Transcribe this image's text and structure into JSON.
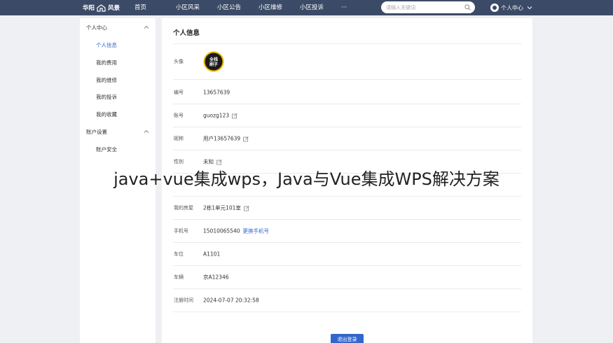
{
  "brand": {
    "name": "华阳",
    "name2": "风景"
  },
  "nav": [
    "首页",
    "小区风采",
    "小区公告",
    "小区维修",
    "小区投诉",
    "···"
  ],
  "search": {
    "placeholder": "请输入关键词",
    "value": ""
  },
  "user_menu": {
    "label": "个人中心"
  },
  "sidebar": {
    "groups": [
      {
        "label": "个人中心",
        "items": [
          "个人信息",
          "我的费用",
          "我的维修",
          "我的投诉",
          "我的收藏"
        ]
      },
      {
        "label": "账户设置",
        "items": [
          "账户安全"
        ]
      }
    ],
    "active": "个人信息"
  },
  "profile": {
    "title": "个人信息",
    "avatar_label": "头像",
    "avatar_badge": "全栈 刷子",
    "rows": [
      {
        "label": "编号",
        "value": "13657639"
      },
      {
        "label": "账号",
        "value": "guozg123"
      },
      {
        "label": "昵称",
        "value": "用户13657639"
      },
      {
        "label": "性别",
        "value": "未知"
      },
      {
        "label": "",
        "value": ""
      },
      {
        "label": "我的房屋",
        "value": "2栋1单元101室"
      },
      {
        "label": "手机号",
        "value": "15010065540",
        "link": "更换手机号"
      },
      {
        "label": "车位",
        "value": "A1101"
      },
      {
        "label": "车辆",
        "value": "京A12346"
      },
      {
        "label": "注册时间",
        "value": "2024-07-07 20:32:58"
      }
    ],
    "logout_label": "退出登录"
  },
  "overlay_caption": "java+vue集成wps，Java与Vue集成WPS解决方案",
  "colors": {
    "topbar": "#3b4a66",
    "accent": "#3366cc",
    "background": "#eef0f3"
  },
  "icons": [
    "home-logo-icon",
    "search-icon",
    "user-avatar-icon",
    "chevron-down-icon",
    "chevron-up-icon",
    "edit-icon"
  ]
}
